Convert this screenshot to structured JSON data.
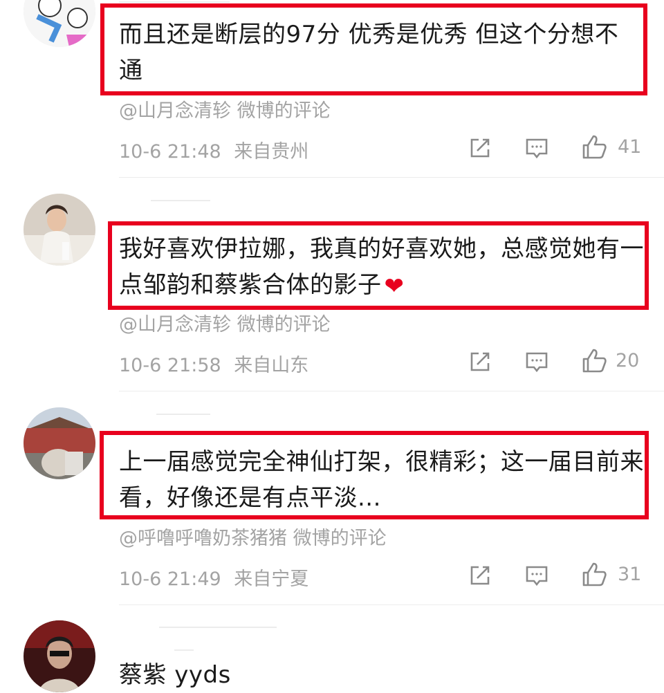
{
  "comments": [
    {
      "text": "而且还是断层的97分 优秀是优秀 但这个分想不通",
      "source": "@山月念清轸 微博的评论",
      "time": "10-6 21:48",
      "location": "来自贵州",
      "likes": "41"
    },
    {
      "text": "我好喜欢伊拉娜，我真的好喜欢她，总感觉她有一点邹韵和蔡紫合体的影子",
      "emoji": "❤",
      "source": "@山月念清轸 微博的评论",
      "time": "10-6 21:58",
      "location": "来自山东",
      "likes": "20"
    },
    {
      "text": "上一届感觉完全神仙打架，很精彩；这一届目前来看，好像还是有点平淡...",
      "source": "@呼噜呼噜奶茶猪猪 微博的评论",
      "time": "10-6 21:49",
      "location": "来自宁夏",
      "likes": "31"
    },
    {
      "text": "蔡紫 yyds"
    }
  ],
  "icons": [
    "share-icon",
    "comment-icon",
    "like-icon"
  ],
  "colors": {
    "highlight": "#e8001e",
    "meta_text": "#a3a3a3",
    "body_text": "#1a1a1a"
  }
}
